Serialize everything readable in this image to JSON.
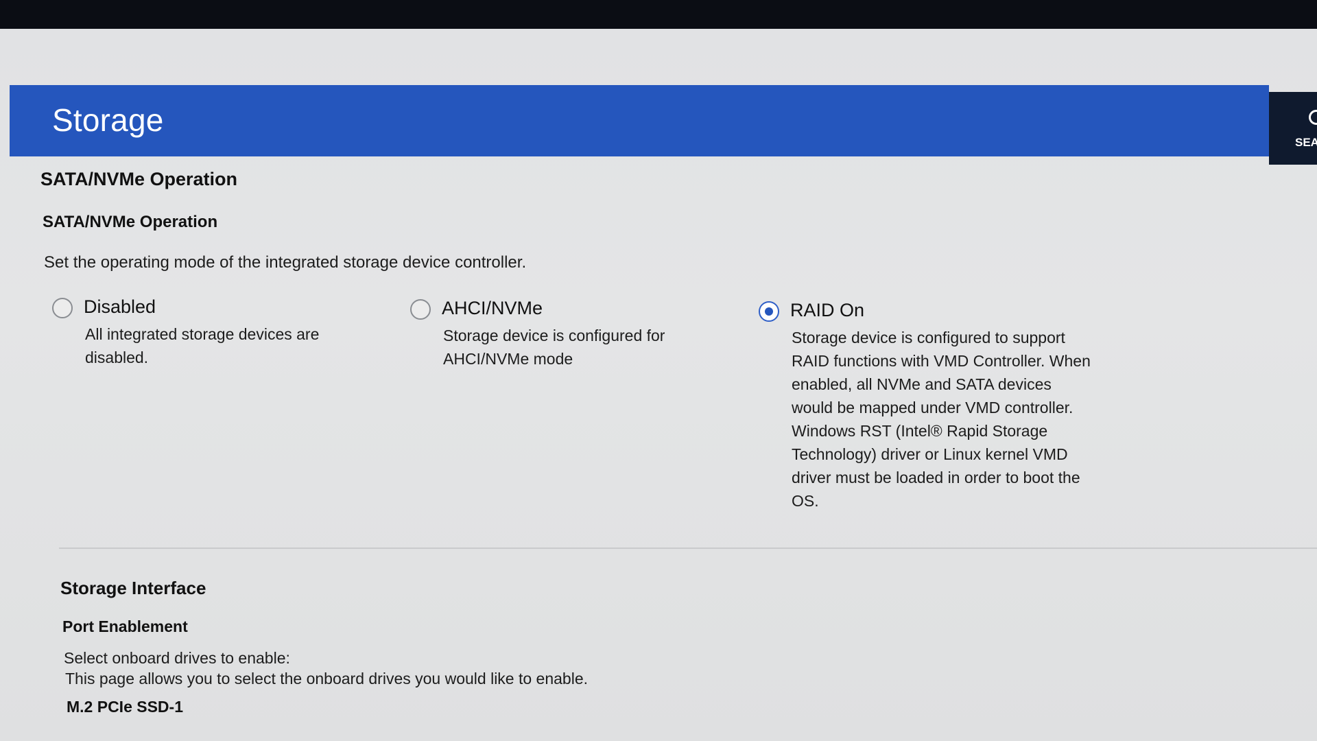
{
  "page": {
    "title": "Storage",
    "search_label": "SEA"
  },
  "sata_section": {
    "heading": "SATA/NVMe Operation",
    "setting_title": "SATA/NVMe Operation",
    "description": "Set the operating mode of the integrated storage device controller.",
    "options": [
      {
        "label": "Disabled",
        "selected": false,
        "description": "All integrated storage devices are disabled."
      },
      {
        "label": "AHCI/NVMe",
        "selected": false,
        "description": "Storage device is configured for AHCI/NVMe mode"
      },
      {
        "label": "RAID On",
        "selected": true,
        "description": "Storage device is configured to support RAID functions with VMD Controller. When enabled, all NVMe and SATA devices would be mapped under VMD controller. Windows RST (Intel® Rapid Storage Technology) driver or Linux kernel VMD driver must be loaded in order to boot the OS."
      }
    ]
  },
  "storage_interface": {
    "heading": "Storage Interface",
    "setting_title": "Port Enablement",
    "line1": "Select onboard drives to enable:",
    "line2": "This page allows you to select the onboard drives you would like to enable.",
    "drive_label": "M.2 PCIe SSD-1"
  },
  "colors": {
    "title_bar": "#2556bd",
    "background": "#e2e3e4",
    "radio_selected": "#2556bd"
  }
}
